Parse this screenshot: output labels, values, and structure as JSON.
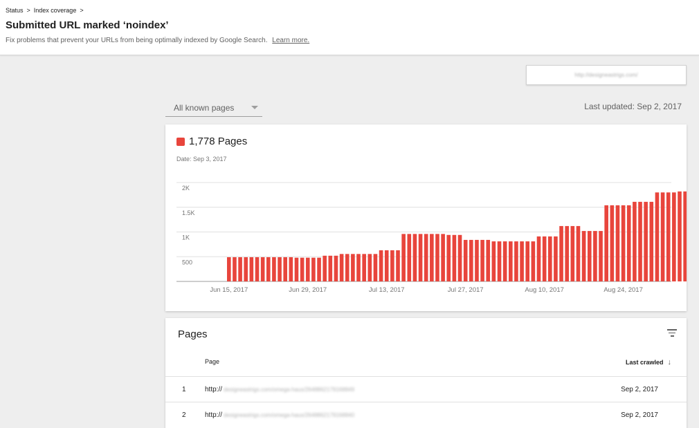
{
  "breadcrumb": {
    "items": [
      "Status",
      "Index coverage"
    ],
    "separator": ">"
  },
  "title": "Submitted URL marked ‘noindex’",
  "subtitle": "Fix problems that prevent your URLs from being optimally indexed by Google Search.",
  "learn_more": "Learn more.",
  "property_selector": {
    "value": "http://designeastrigs.com/"
  },
  "filter_dropdown": {
    "selected": "All known pages"
  },
  "last_updated": "Last updated: Sep 2, 2017",
  "chart_card": {
    "count_label": "1,778 Pages",
    "date_label": "Date: Sep 3, 2017"
  },
  "chart_data": {
    "type": "bar",
    "color": "#e8453c",
    "y_ticks": [
      "500",
      "1K",
      "1.5K",
      "2K"
    ],
    "ylim": [
      0,
      2000
    ],
    "x_ticks": [
      {
        "label": "Jun 15, 2017",
        "index": 0
      },
      {
        "label": "Jun 29, 2017",
        "index": 14
      },
      {
        "label": "Jul 13, 2017",
        "index": 28
      },
      {
        "label": "Jul 27, 2017",
        "index": 42
      },
      {
        "label": "Aug 10, 2017",
        "index": 56
      },
      {
        "label": "Aug 24, 2017",
        "index": 70
      }
    ],
    "values": [
      490,
      490,
      490,
      490,
      490,
      490,
      490,
      490,
      490,
      490,
      490,
      490,
      480,
      480,
      480,
      480,
      480,
      520,
      520,
      520,
      555,
      555,
      555,
      555,
      555,
      555,
      555,
      630,
      630,
      630,
      630,
      960,
      960,
      960,
      960,
      960,
      960,
      960,
      960,
      940,
      940,
      940,
      840,
      840,
      840,
      840,
      840,
      810,
      810,
      810,
      810,
      810,
      810,
      810,
      810,
      910,
      910,
      910,
      910,
      1120,
      1120,
      1120,
      1120,
      1020,
      1020,
      1020,
      1020,
      1540,
      1540,
      1540,
      1540,
      1540,
      1610,
      1610,
      1610,
      1610,
      1800,
      1800,
      1800,
      1800,
      1820,
      1820,
      1820,
      1780,
      1780,
      1780,
      1780,
      1778
    ]
  },
  "pages_card": {
    "title": "Pages",
    "columns": {
      "page": "Page",
      "last_crawled": "Last crawled"
    },
    "rows": [
      {
        "num": "1",
        "url_prefix": "http://",
        "url_rest": "designeastrigs.com/omega-haus/2648862179168849",
        "crawled": "Sep 2, 2017"
      },
      {
        "num": "2",
        "url_prefix": "http://",
        "url_rest": "designeastrigs.com/omega-haus/2648862179168840",
        "crawled": "Sep 2, 2017"
      }
    ]
  }
}
